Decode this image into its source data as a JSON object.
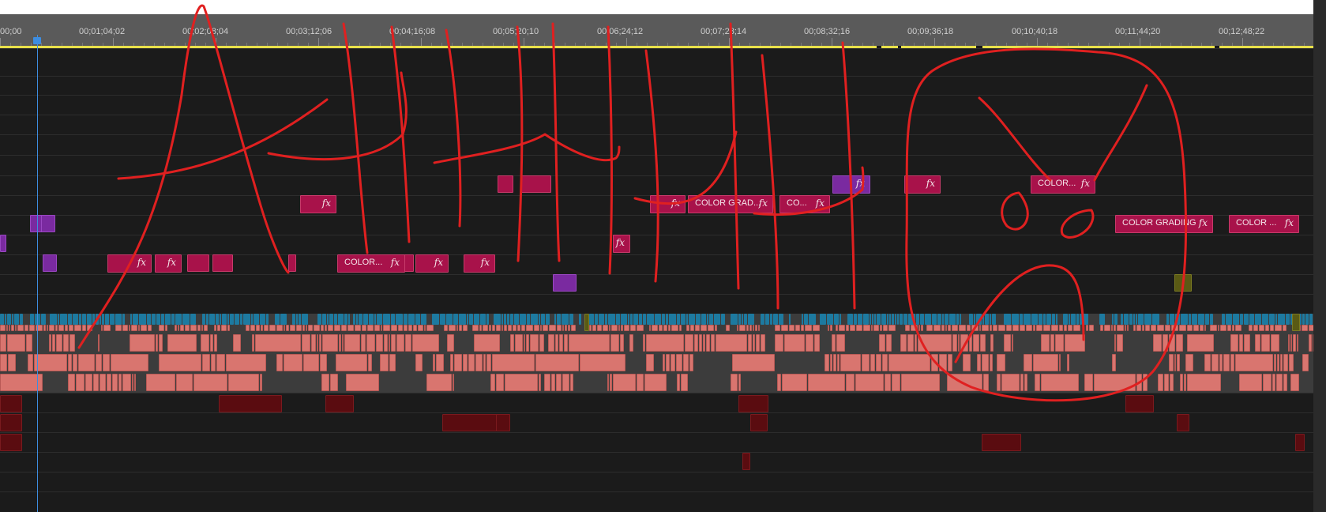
{
  "timeline": {
    "ruler": {
      "timecodes": [
        "00;00",
        "00;01;04;02",
        "00;02;08;04",
        "00;03;12;06",
        "00;04;16;08",
        "00;05;20;10",
        "00;06;24;12",
        "00;07;28;14",
        "00;08;32;16",
        "00;09;36;18",
        "00;10;40;18",
        "00;11;44;20",
        "00;12;48;22"
      ]
    },
    "clip_labels": {
      "color_short": "COLOR...",
      "color_trunc": "COLOR...",
      "color_grad": "COLOR GRAD...",
      "co": "CO...",
      "color_grading": "COLOR GRADING",
      "color_dots": "COLOR ...",
      "fx": "fx"
    },
    "colors": {
      "ruler_bg": "#5a5a5a",
      "work_area": "#e8e04a",
      "playhead": "#3d8de0",
      "annotation": "#e02020",
      "adjustment_clip": "#a8124a",
      "nested_clip": "#7a2aa0",
      "video_clip": "#d9756f",
      "audio_clip": "#5a0c10",
      "graphics_clip": "#1d7aa0"
    },
    "annotation": {
      "type": "freehand-drawing",
      "depicts": "letters A H H H H H and an angry face scribbled in red over the timeline"
    }
  }
}
